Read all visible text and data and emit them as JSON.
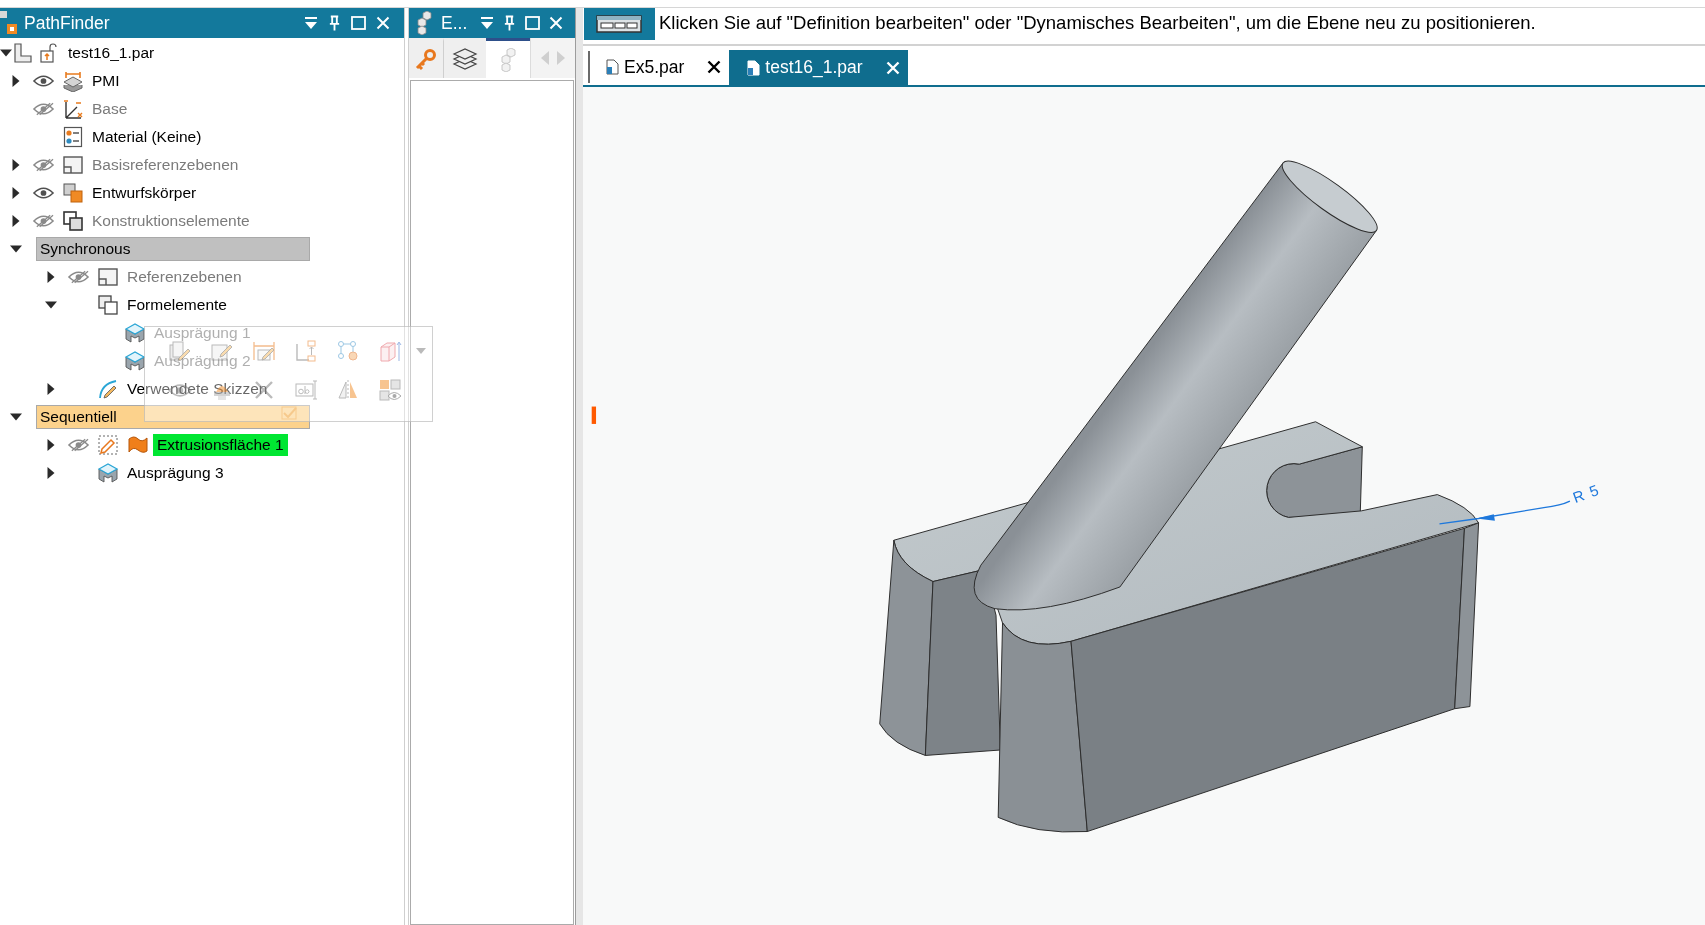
{
  "pathfinder": {
    "title": "PathFinder",
    "tree": [
      {
        "label": "test16_1.par",
        "kind": "document",
        "dimmed": false,
        "expandable": true,
        "expanded": true,
        "children": [
          {
            "label": "PMI",
            "kind": "pmi",
            "visible": true,
            "dimmed": false,
            "expandable": true,
            "expanded": false
          },
          {
            "label": "Base",
            "kind": "axes",
            "visible": false,
            "dimmed": true,
            "expandable": false
          },
          {
            "label": "Material (Keine)",
            "kind": "material",
            "dimmed": false,
            "expandable": false
          },
          {
            "label": "Basisreferenzebenen",
            "kind": "planes",
            "visible": false,
            "dimmed": true,
            "expandable": true,
            "expanded": false
          },
          {
            "label": "Entwurfskörper",
            "kind": "body",
            "visible": true,
            "dimmed": false,
            "expandable": true,
            "expanded": false
          },
          {
            "label": "Konstruktionselemente",
            "kind": "construction",
            "visible": false,
            "dimmed": true,
            "expandable": true,
            "expanded": false
          },
          {
            "label": "Synchronous",
            "kind": "group",
            "color": "#c0c0c0",
            "dimmed": false,
            "expandable": true,
            "expanded": true,
            "children": [
              {
                "label": "Referenzebenen",
                "kind": "planes",
                "visible": false,
                "dimmed": true,
                "expandable": true,
                "expanded": false
              },
              {
                "label": "Formelemente",
                "kind": "features",
                "dimmed": false,
                "expandable": true,
                "expanded": true,
                "children": [
                  {
                    "label": "Ausprägung 1",
                    "kind": "protrusion",
                    "dimmed": true,
                    "expandable": false
                  },
                  {
                    "label": "Ausprägung 2",
                    "kind": "protrusion",
                    "dimmed": true,
                    "expandable": false
                  }
                ]
              },
              {
                "label": "Verwendete Skizzen",
                "kind": "sketches",
                "dimmed": false,
                "expandable": true,
                "expanded": false
              }
            ]
          },
          {
            "label": "Sequentiell",
            "kind": "group",
            "color": "#fcd28c",
            "dimmed": false,
            "expandable": true,
            "expanded": true,
            "children": [
              {
                "label": "Extrusionsfläche 1",
                "kind": "surface",
                "visible": false,
                "color": "#00e632",
                "dimmed": false,
                "expandable": true,
                "expanded": false
              },
              {
                "label": "Ausprägung 3",
                "kind": "protrusion",
                "dimmed": false,
                "expandable": true,
                "expanded": false
              }
            ]
          }
        ]
      }
    ]
  },
  "docked_panel": {
    "title": "E...",
    "tabs": [
      {
        "kind": "key",
        "selected": false
      },
      {
        "kind": "layers",
        "selected": false
      },
      {
        "kind": "cubes",
        "selected": true
      }
    ],
    "scroll_arrows": {
      "disabled": true
    }
  },
  "prompt_bar": {
    "message": "Klicken Sie auf \"Definition bearbeiten\" oder \"Dynamisches Bearbeiten\", um die Ebene neu zu positionieren."
  },
  "document_tabs": [
    {
      "label": "Ex5.par",
      "selected": false
    },
    {
      "label": "test16_1.par",
      "selected": true
    }
  ],
  "viewport": {
    "dimension": "R5"
  }
}
